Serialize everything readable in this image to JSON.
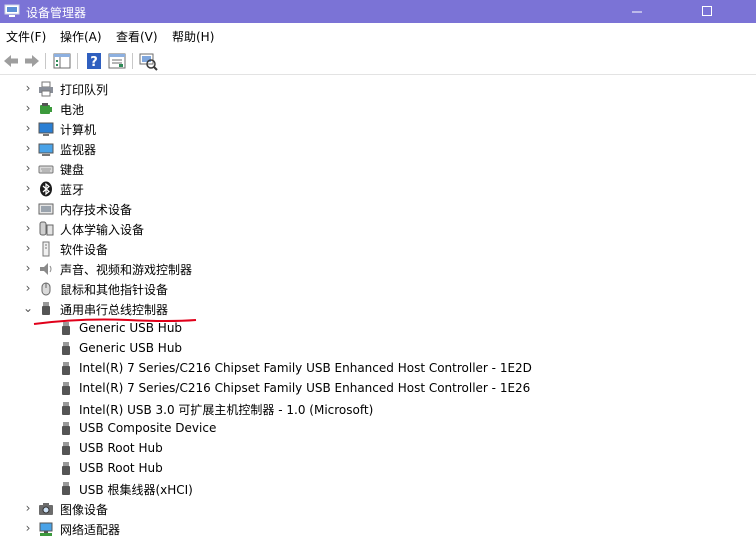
{
  "window": {
    "title": "设备管理器"
  },
  "menu": [
    "文件(F)",
    "操作(A)",
    "查看(V)",
    "帮助(H)"
  ],
  "tree": {
    "categories": [
      {
        "label": "打印队列",
        "icon": "printer-icon",
        "expanded": false
      },
      {
        "label": "电池",
        "icon": "battery-icon",
        "expanded": false
      },
      {
        "label": "计算机",
        "icon": "computer-icon",
        "expanded": false
      },
      {
        "label": "监视器",
        "icon": "monitor-icon",
        "expanded": false
      },
      {
        "label": "键盘",
        "icon": "keyboard-icon",
        "expanded": false
      },
      {
        "label": "蓝牙",
        "icon": "bluetooth-icon",
        "expanded": false
      },
      {
        "label": "内存技术设备",
        "icon": "memory-icon",
        "expanded": false
      },
      {
        "label": "人体学输入设备",
        "icon": "hid-icon",
        "expanded": false
      },
      {
        "label": "软件设备",
        "icon": "software-device-icon",
        "expanded": false
      },
      {
        "label": "声音、视频和游戏控制器",
        "icon": "speaker-icon",
        "expanded": false
      },
      {
        "label": "鼠标和其他指针设备",
        "icon": "mouse-icon",
        "expanded": false
      },
      {
        "label": "通用串行总线控制器",
        "icon": "usb-icon",
        "expanded": true
      }
    ],
    "usb_children": [
      "Generic USB Hub",
      "Generic USB Hub",
      "Intel(R) 7 Series/C216 Chipset Family USB Enhanced Host Controller - 1E2D",
      "Intel(R) 7 Series/C216 Chipset Family USB Enhanced Host Controller - 1E26",
      "Intel(R) USB 3.0 可扩展主机控制器 - 1.0 (Microsoft)",
      "USB Composite Device",
      "USB Root Hub",
      "USB Root Hub",
      "USB 根集线器(xHCI)"
    ],
    "after": [
      {
        "label": "图像设备",
        "icon": "camera-icon",
        "expanded": false
      },
      {
        "label": "网络适配器",
        "icon": "network-adapter-icon",
        "expanded": false
      }
    ]
  },
  "colors": {
    "titlebar": "#7b73d6",
    "annotation": "#e0001a"
  }
}
